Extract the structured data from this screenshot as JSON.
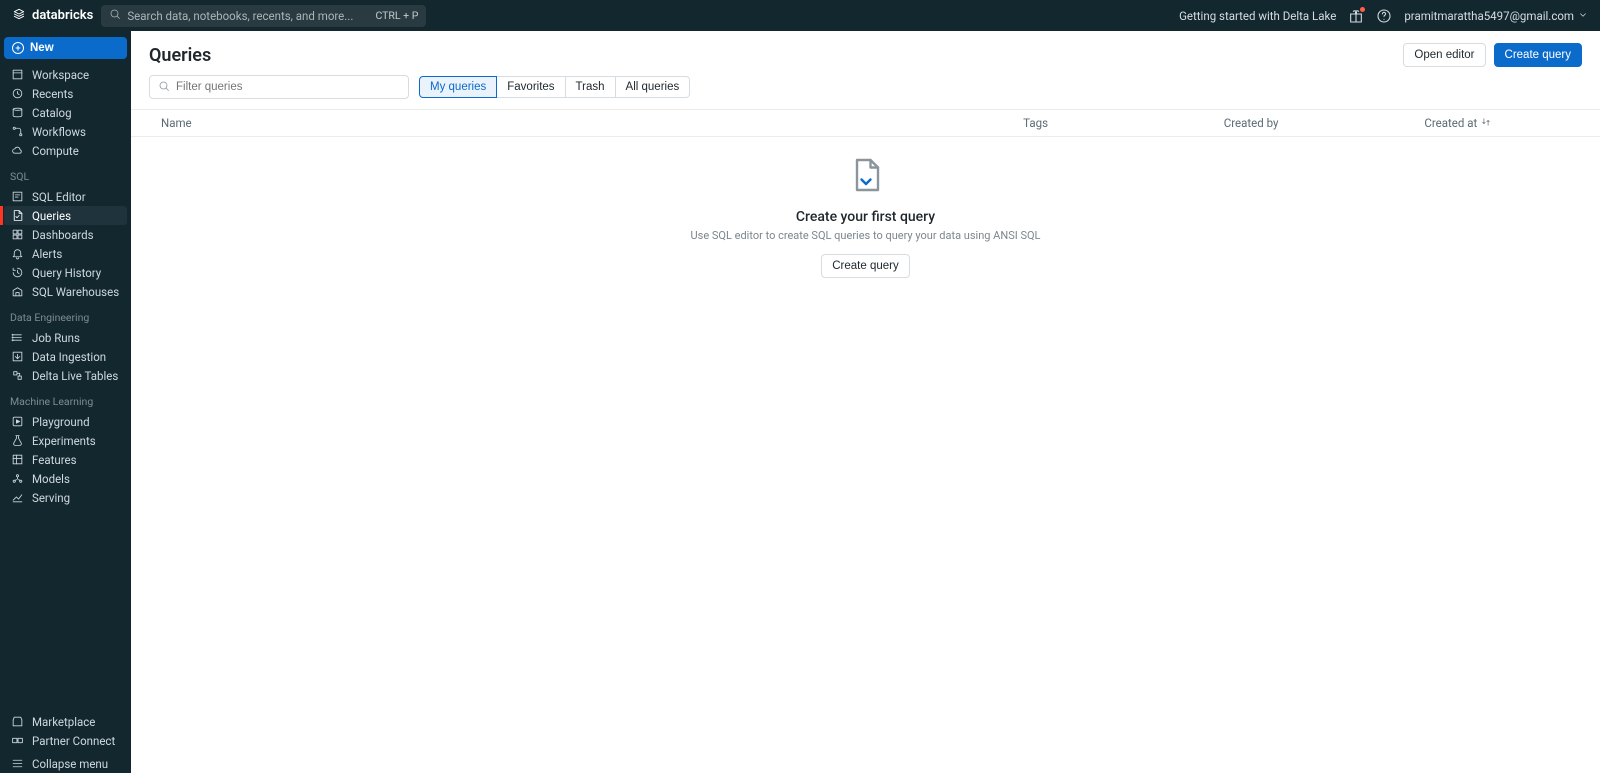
{
  "topbar": {
    "brand": "databricks",
    "search_placeholder": "Search data, notebooks, recents, and more...",
    "search_shortcut": "CTRL + P",
    "getting_started": "Getting started with Delta Lake",
    "user_email": "pramitmarattha5497@gmail.com"
  },
  "sidebar": {
    "new_label": "New",
    "top_items": [
      {
        "label": "Workspace",
        "icon": "workspace"
      },
      {
        "label": "Recents",
        "icon": "clock"
      },
      {
        "label": "Catalog",
        "icon": "catalog"
      },
      {
        "label": "Workflows",
        "icon": "flow"
      },
      {
        "label": "Compute",
        "icon": "cloud"
      }
    ],
    "sections": [
      {
        "label": "SQL",
        "items": [
          {
            "label": "SQL Editor",
            "icon": "sql-editor"
          },
          {
            "label": "Queries",
            "icon": "queries",
            "active": true
          },
          {
            "label": "Dashboards",
            "icon": "dashboards"
          },
          {
            "label": "Alerts",
            "icon": "bell"
          },
          {
            "label": "Query History",
            "icon": "history"
          },
          {
            "label": "SQL Warehouses",
            "icon": "warehouse"
          }
        ]
      },
      {
        "label": "Data Engineering",
        "items": [
          {
            "label": "Job Runs",
            "icon": "jobruns"
          },
          {
            "label": "Data Ingestion",
            "icon": "ingest"
          },
          {
            "label": "Delta Live Tables",
            "icon": "dlt"
          }
        ]
      },
      {
        "label": "Machine Learning",
        "items": [
          {
            "label": "Playground",
            "icon": "play"
          },
          {
            "label": "Experiments",
            "icon": "flask"
          },
          {
            "label": "Features",
            "icon": "features"
          },
          {
            "label": "Models",
            "icon": "models"
          },
          {
            "label": "Serving",
            "icon": "serving"
          }
        ]
      }
    ],
    "footer_items": [
      {
        "label": "Marketplace",
        "icon": "store"
      },
      {
        "label": "Partner Connect",
        "icon": "partner"
      }
    ],
    "collapse_label": "Collapse menu"
  },
  "page": {
    "title": "Queries",
    "open_editor": "Open editor",
    "create_query": "Create query",
    "filter_placeholder": "Filter queries",
    "tabs": [
      {
        "label": "My queries",
        "active": true
      },
      {
        "label": "Favorites"
      },
      {
        "label": "Trash"
      },
      {
        "label": "All queries"
      }
    ],
    "columns": {
      "name": "Name",
      "tags": "Tags",
      "created_by": "Created by",
      "created_at": "Created at"
    },
    "empty": {
      "title": "Create your first query",
      "subtitle": "Use SQL editor to create SQL queries to query your data using ANSI SQL",
      "cta": "Create query"
    }
  }
}
